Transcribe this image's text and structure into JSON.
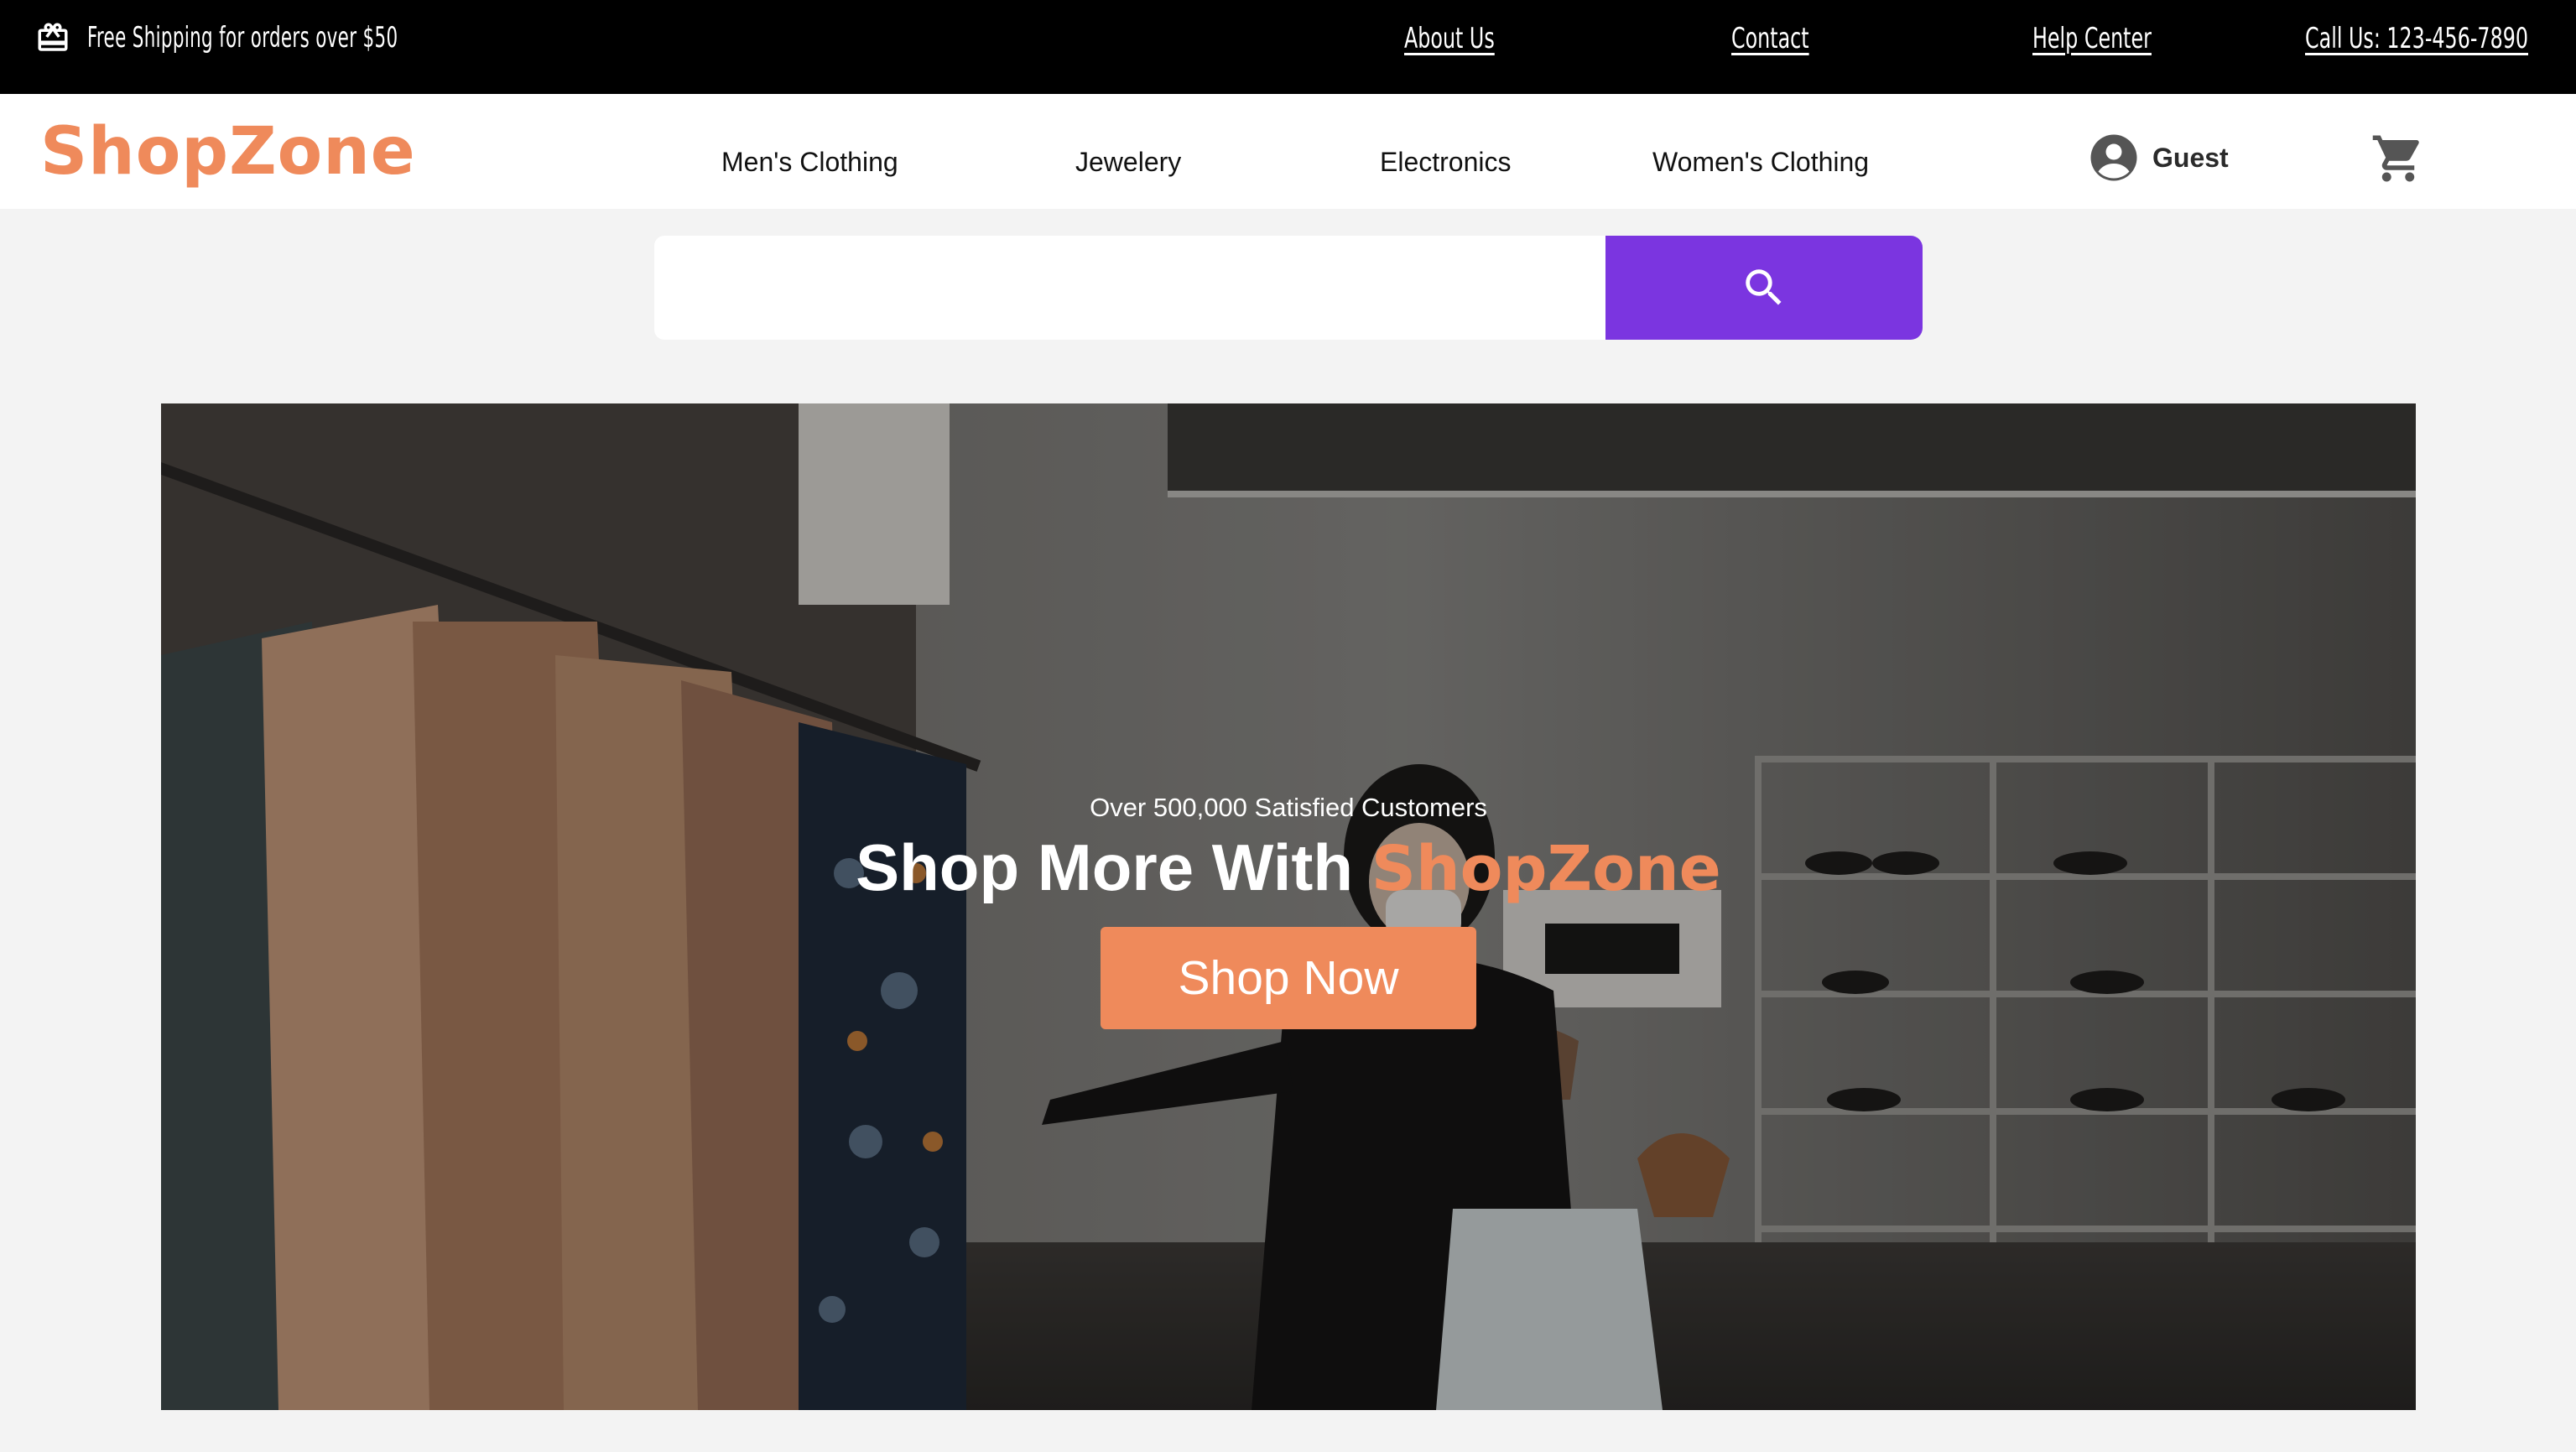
{
  "topbar": {
    "promo_icon": "gift-card-icon",
    "promo_text": "Free Shipping for orders over $50",
    "links": {
      "about": "About Us",
      "contact": "Contact",
      "help": "Help Center",
      "call": "Call Us: 123-456-7890"
    }
  },
  "header": {
    "logo": "ShopZone",
    "nav": {
      "mens": "Men's Clothing",
      "jewelery": "Jewelery",
      "electronics": "Electronics",
      "womens": "Women's Clothing"
    },
    "user_icon": "account-circle-icon",
    "user_label": "Guest",
    "cart_icon": "shopping-cart-icon"
  },
  "search": {
    "placeholder": "",
    "value": "",
    "button_icon": "search-icon"
  },
  "hero": {
    "subtitle": "Over 500,000 Satisfied Customers",
    "title_prefix": "Shop More With",
    "title_brand": "ShopZone",
    "button_label": "Shop Now"
  },
  "colors": {
    "accent": "#ef8a5b",
    "search_button": "#7b35e0",
    "topbar_bg": "#000000",
    "page_bg": "#f3f3f3"
  }
}
